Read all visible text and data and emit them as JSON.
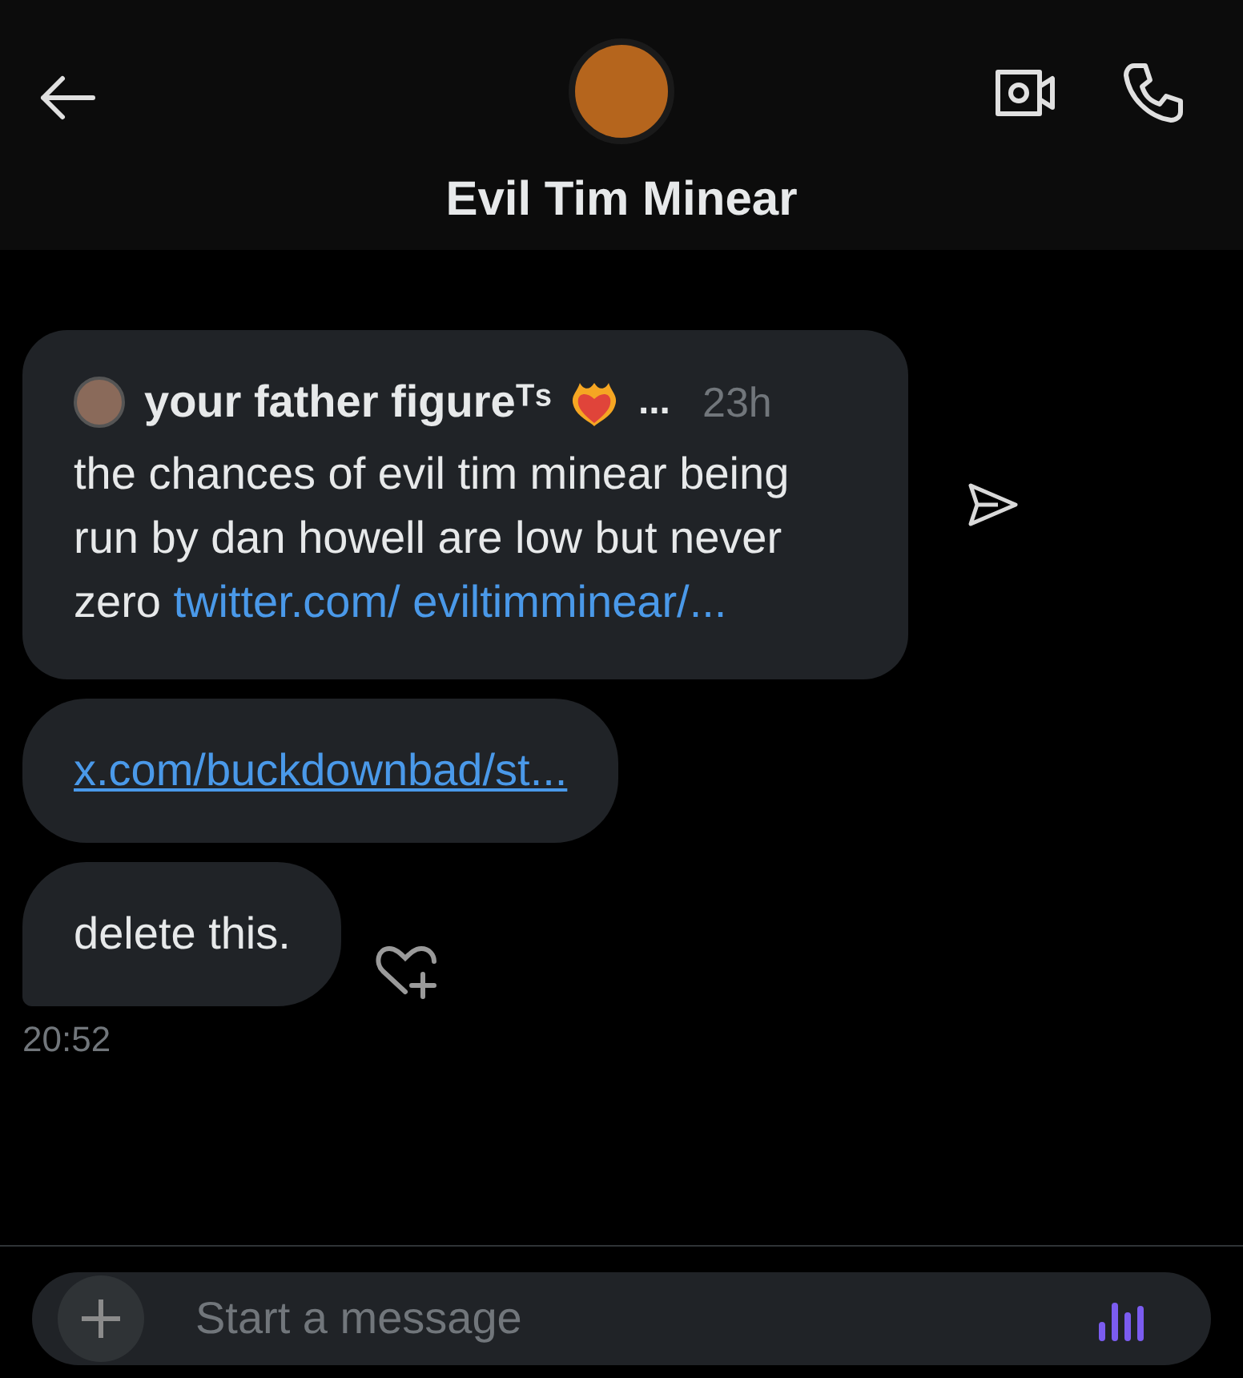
{
  "header": {
    "title": "Evil Tim Minear"
  },
  "messages": [
    {
      "kind": "quote",
      "author": "your father figureᵀˢ",
      "ellipsis": "...",
      "time": "23h",
      "text": "the chances of evil tim minear being run by dan howell are low but never zero",
      "link": "twitter.com/ eviltimminear/..."
    },
    {
      "kind": "link",
      "text": "x.com/buckdownbad/st..."
    },
    {
      "kind": "text",
      "text": "delete this."
    }
  ],
  "timestamp": "20:52",
  "composer": {
    "placeholder": "Start a message"
  }
}
